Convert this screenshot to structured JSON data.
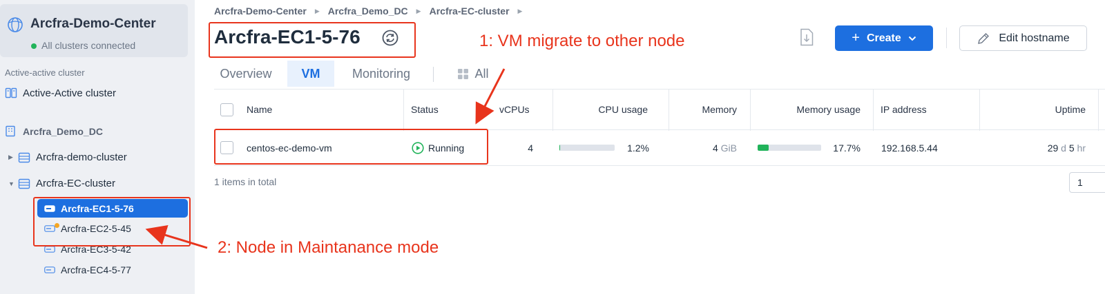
{
  "sidebar": {
    "datacenter_card": {
      "title": "Arcfra-Demo-Center",
      "status": "All clusters connected"
    },
    "section_label": "Active-active cluster",
    "active_active_item": "Active-Active cluster",
    "datacenter_item": "Arcfra_Demo_DC",
    "clusters": [
      {
        "label": "Arcfra-demo-cluster",
        "expanded": false
      },
      {
        "label": "Arcfra-EC-cluster",
        "expanded": true
      }
    ],
    "nodes": [
      {
        "label": "Arcfra-EC1-5-76",
        "selected": true
      },
      {
        "label": "Arcfra-EC2-5-45",
        "maintenance": true
      },
      {
        "label": "Arcfra-EC3-5-42"
      },
      {
        "label": "Arcfra-EC4-5-77"
      }
    ]
  },
  "breadcrumb": [
    "Arcfra-Demo-Center",
    "Arcfra_Demo_DC",
    "Arcfra-EC-cluster"
  ],
  "page_title": "Arcfra-EC1-5-76",
  "toolbar": {
    "create_label": "Create",
    "edit_label": "Edit hostname"
  },
  "tabs": {
    "overview": "Overview",
    "vm": "VM",
    "monitoring": "Monitoring",
    "filter": "All"
  },
  "table": {
    "columns": {
      "name": "Name",
      "status": "Status",
      "vcpus": "vCPUs",
      "cpu_usage": "CPU usage",
      "memory": "Memory",
      "memory_usage": "Memory usage",
      "ip": "IP address",
      "uptime": "Uptime"
    },
    "rows": [
      {
        "name": "centos-ec-demo-vm",
        "status": "Running",
        "vcpus": "4",
        "cpu_usage": "1.2%",
        "cpu_fraction": 0.012,
        "memory_value": "4",
        "memory_unit": "GiB",
        "memory_usage": "17.7%",
        "memory_fraction": 0.177,
        "ip": "192.168.5.44",
        "uptime_days": "29",
        "uptime_d_unit": "d",
        "uptime_hours": "5",
        "uptime_h_unit": "hr"
      }
    ],
    "total_text": "1 items in total",
    "page_number": "1"
  },
  "annotations": {
    "vm_migrate": "1: VM migrate to other node",
    "maintenance": "2:  Node in Maintanance mode"
  },
  "colors": {
    "accent": "#1d6fe0",
    "running": "#21b35a",
    "annotation": "#e8341c",
    "maintenance": "#f5a623"
  }
}
